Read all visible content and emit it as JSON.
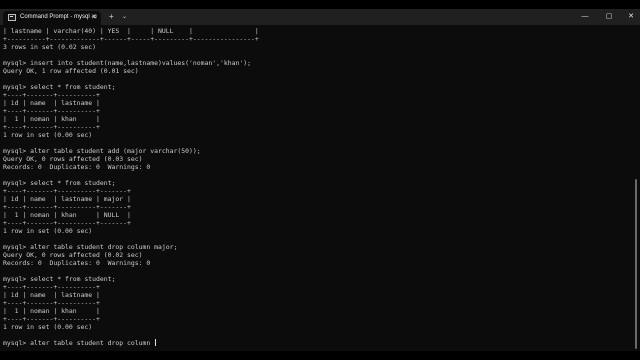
{
  "window": {
    "tab_title": "Command Prompt - mysql -u",
    "tab_close": "✕",
    "new_tab": "+",
    "tab_dropdown": "⌄",
    "minimize": "—",
    "maximize": "▢",
    "close": "✕"
  },
  "console": {
    "lines": [
      "| lastname | varchar(40) | YES  |     | NULL    |                |",
      "+----------+-------------+------+-----+---------+----------------+",
      "3 rows in set (0.02 sec)",
      "",
      "mysql> insert into student(name,lastname)values('noman','khan');",
      "Query OK, 1 row affected (0.01 sec)",
      "",
      "mysql> select * from student;",
      "+----+-------+----------+",
      "| id | name  | lastname |",
      "+----+-------+----------+",
      "|  1 | noman | khan     |",
      "+----+-------+----------+",
      "1 row in set (0.00 sec)",
      "",
      "mysql> alter table student add (major varchar(50));",
      "Query OK, 0 rows affected (0.03 sec)",
      "Records: 0  Duplicates: 0  Warnings: 0",
      "",
      "mysql> select * from student;",
      "+----+-------+----------+-------+",
      "| id | name  | lastname | major |",
      "+----+-------+----------+-------+",
      "|  1 | noman | khan     | NULL  |",
      "+----+-------+----------+-------+",
      "1 row in set (0.00 sec)",
      "",
      "mysql> alter table student drop column major;",
      "Query OK, 0 rows affected (0.02 sec)",
      "Records: 0  Duplicates: 0  Warnings: 0",
      "",
      "mysql> select * from student;",
      "+----+-------+----------+",
      "| id | name  | lastname |",
      "+----+-------+----------+",
      "|  1 | noman | khan     |",
      "+----+-------+----------+",
      "1 row in set (0.00 sec)",
      "",
      "mysql> alter table student drop column "
    ]
  },
  "colors": {
    "terminal_bg": "#0c0c0c",
    "terminal_text": "#cccccc",
    "titlebar_bg": "#202020"
  }
}
